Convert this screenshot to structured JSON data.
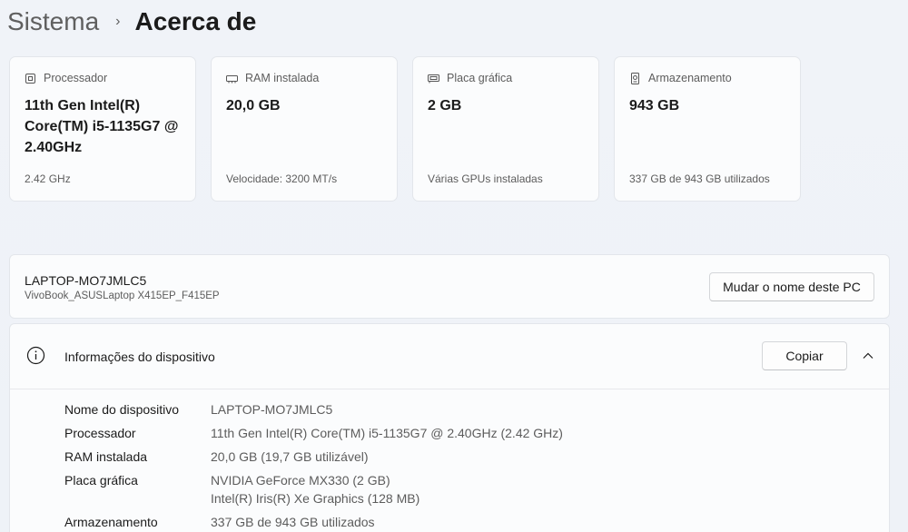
{
  "breadcrumb": {
    "parent": "Sistema",
    "separator": "›",
    "current": "Acerca de"
  },
  "cards": [
    {
      "label": "Processador",
      "icon": "processor-icon",
      "value": "11th Gen Intel(R) Core(TM) i5-1135G7 @ 2.40GHz",
      "sub": "2.42 GHz"
    },
    {
      "label": "RAM instalada",
      "icon": "ram-icon",
      "value": "20,0 GB",
      "sub": "Velocidade: 3200 MT/s"
    },
    {
      "label": "Placa gráfica",
      "icon": "gpu-icon",
      "value": "2 GB",
      "sub": "Várias GPUs instaladas"
    },
    {
      "label": "Armazenamento",
      "icon": "storage-icon",
      "value": "943 GB",
      "sub": "337 GB de 943 GB utilizados"
    }
  ],
  "device": {
    "name": "LAPTOP-MO7JMLC5",
    "model": "VivoBook_ASUSLaptop X415EP_F415EP",
    "rename_label": "Mudar o nome deste PC"
  },
  "info": {
    "title": "Informações do dispositivo",
    "copy_label": "Copiar",
    "rows": [
      {
        "label": "Nome do dispositivo",
        "value": "LAPTOP-MO7JMLC5",
        "value2": ""
      },
      {
        "label": "Processador",
        "value": "11th Gen Intel(R) Core(TM) i5-1135G7 @ 2.40GHz (2.42 GHz)",
        "value2": ""
      },
      {
        "label": "RAM instalada",
        "value": "20,0 GB (19,7 GB utilizável)",
        "value2": ""
      },
      {
        "label": "Placa gráfica",
        "value": "NVIDIA GeForce MX330 (2 GB)",
        "value2": "Intel(R) Iris(R) Xe Graphics (128 MB)"
      },
      {
        "label": "Armazenamento",
        "value": "337 GB de 943 GB utilizados",
        "value2": ""
      }
    ]
  }
}
